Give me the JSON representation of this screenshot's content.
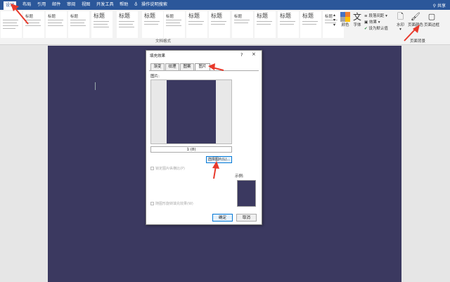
{
  "ribbon_tabs": [
    "设计",
    "布局",
    "引用",
    "邮件",
    "审阅",
    "视图",
    "开发工具",
    "帮助",
    "操作说明搜索"
  ],
  "share": "共享",
  "styles": [
    "",
    "标题",
    "标题",
    "标题",
    "标题",
    "标题",
    "标题",
    "标题",
    "标题",
    "标题",
    "标题",
    "标题",
    "标题",
    "标题",
    "标题"
  ],
  "group_label": "文档格式",
  "ribbon_buttons": {
    "colors": "颜色",
    "fonts": "字体",
    "paragraph_spacing": "段落间距",
    "effects": "效果",
    "set_default": "设为默认值",
    "watermark": "水印",
    "page_color": "页面颜色",
    "page_borders": "页面边框",
    "page_background_group": "页面背景"
  },
  "dialog": {
    "title": "填充效果",
    "help": "?",
    "close": "×",
    "tabs": [
      "渐变",
      "纹理",
      "图案",
      "图片"
    ],
    "picture_label": "图片:",
    "picture_name": "1 (8)",
    "select_picture": "选择图片(L)...",
    "lock_aspect": "锁定图片纵横比(P)",
    "rotate_with_shape": "随图形旋转填充效果(W)",
    "sample_label": "示例:",
    "ok": "确定",
    "cancel": "取消"
  },
  "colors": {
    "ribbon_blue": "#2b579a",
    "page_fill": "#3b3960",
    "arrow": "#e83a2c"
  }
}
